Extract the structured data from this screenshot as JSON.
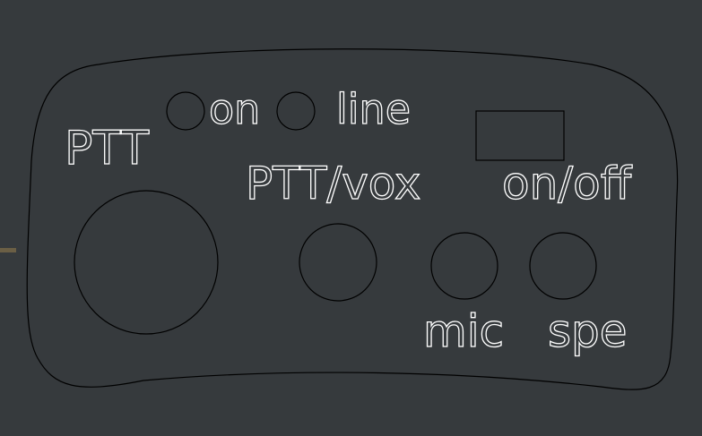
{
  "colors": {
    "background": "#363a3d",
    "outline": "#000000",
    "label": "#ffffff",
    "edge_mark": "#6b5f45"
  },
  "labels": {
    "ptt": "PTT",
    "on": "on",
    "line": "line",
    "ptt_vox": "PTT/vox",
    "on_off": "on/off",
    "mic": "mic",
    "spe": "spe"
  }
}
